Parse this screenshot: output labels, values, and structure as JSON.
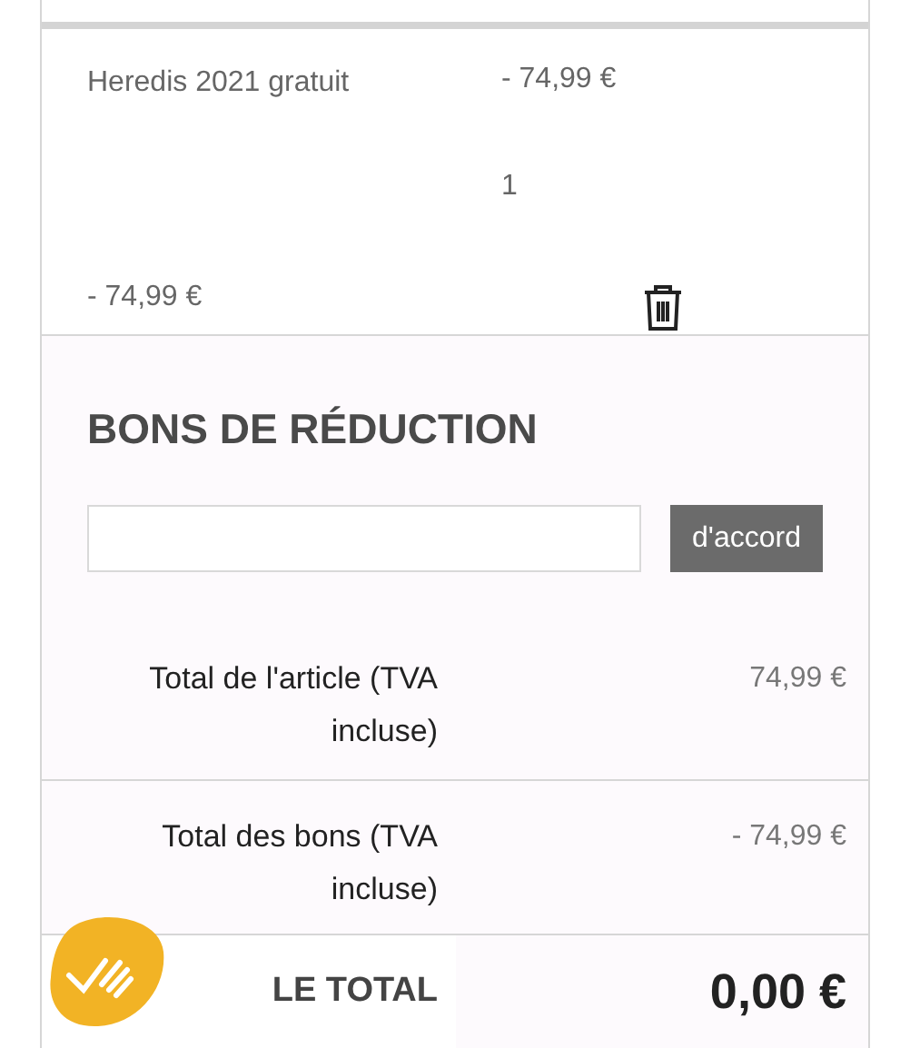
{
  "cart_item": {
    "name": "Heredis 2021 gratuit",
    "unit_price": "- 74,99 €",
    "quantity": "1",
    "line_total": "- 74,99 €"
  },
  "vouchers": {
    "title": "BONS DE RÉDUCTION",
    "button": "d'accord"
  },
  "totals": [
    {
      "label": "Total de l'article (TVA incluse)",
      "value": "74,99 €"
    },
    {
      "label": "Total des bons (TVA incluse)",
      "value": "- 74,99 €"
    }
  ],
  "grand_total": {
    "label": "LE TOTAL",
    "value": "0,00 €"
  }
}
